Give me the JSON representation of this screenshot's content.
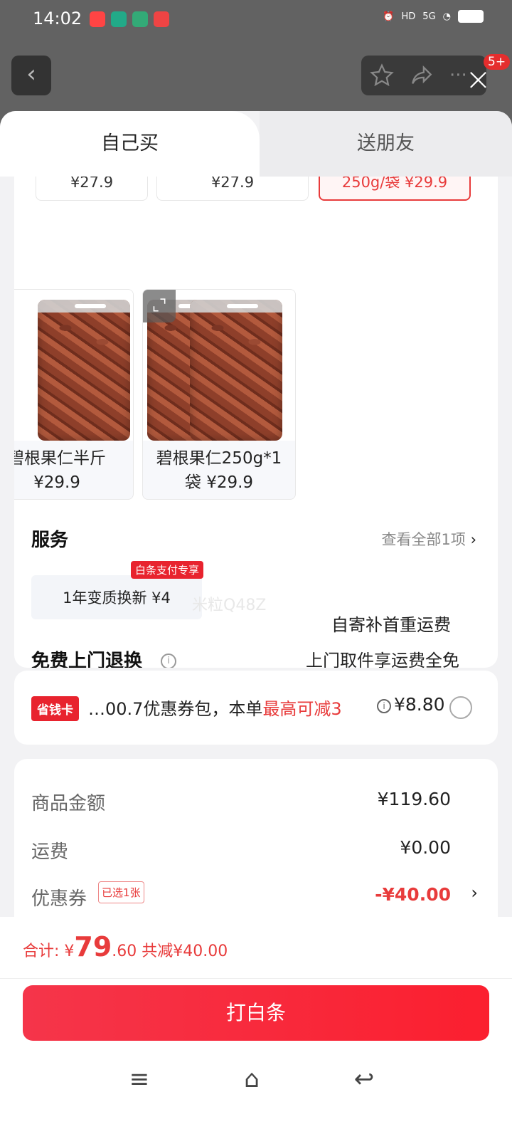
{
  "status": {
    "time": "14:02",
    "network": "5G"
  },
  "header": {
    "back_icon": "‹",
    "badge": "5+",
    "close_icon": "×"
  },
  "tabs": {
    "self": "自己买",
    "friend": "送朋友"
  },
  "variants_top": [
    {
      "label": "¥27.9"
    },
    {
      "label": "¥27.9"
    },
    {
      "label": "250g/袋  ¥29.9",
      "selected": true
    }
  ],
  "products": [
    {
      "name": "碧根果仁半斤",
      "price": "¥29.9"
    },
    {
      "name": "碧根果仁250g*1袋",
      "price": "¥29.9"
    }
  ],
  "service": {
    "title": "服务",
    "view_all": "查看全部1项",
    "chip_label": "1年变质换新  ¥4",
    "chip_tag": "白条支付专享",
    "watermark": "米粒Q48Z"
  },
  "returns": {
    "title": "免费上门退换",
    "line1": "上门取件享运费全免",
    "line2": "自寄补首重运费"
  },
  "coupon": {
    "tag": "省钱卡",
    "text": "…00.7优惠券包，本单",
    "highlight": "最高可减3",
    "price": "¥8.80"
  },
  "summary": {
    "goods_label": "商品金额",
    "goods_value": "¥119.60",
    "shipping_label": "运费",
    "shipping_value": "¥0.00",
    "coupon_label": "优惠券",
    "coupon_tag": "已选1张",
    "coupon_value": "-¥40.00"
  },
  "footer": {
    "total_prefix": "合计: ¥",
    "total_int": "79",
    "total_dec": ".60",
    "saved": "共减¥40.00",
    "pay_button": "打白条"
  }
}
